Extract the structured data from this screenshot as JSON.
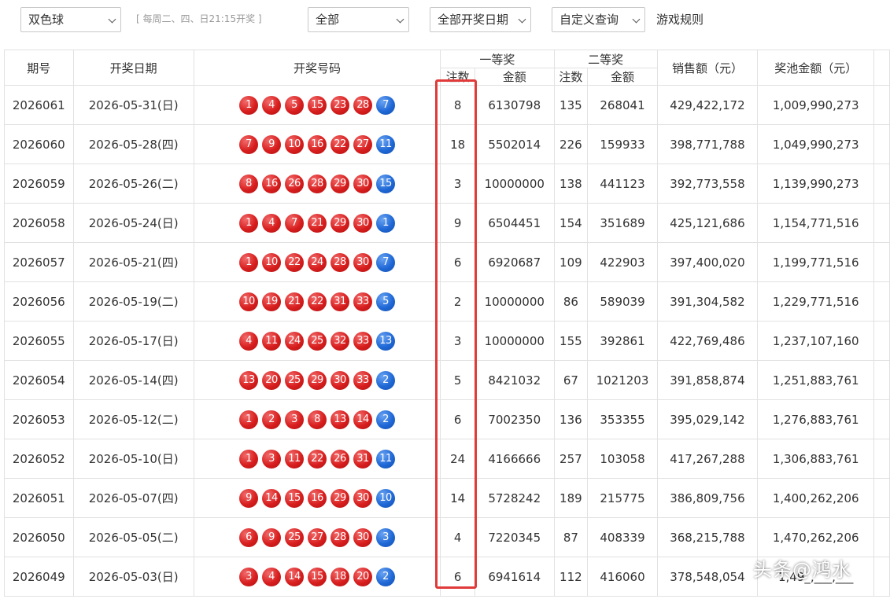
{
  "toolbar": {
    "game_select": "双色球",
    "draw_hint": "[ 每周二、四、日21:15开奖 ]",
    "range_select": "全部",
    "date_select": "全部开奖日期",
    "custom_query": "自定义查询",
    "rules_link": "游戏规则"
  },
  "table": {
    "headers": {
      "issue": "期号",
      "date": "开奖日期",
      "numbers": "开奖号码",
      "first_prize": "一等奖",
      "second_prize": "二等奖",
      "bets": "注数",
      "amount": "金额",
      "sales": "销售额（元）",
      "pool": "奖池金额（元）"
    },
    "rows": [
      {
        "issue": "2026061",
        "date": "2026-05-31(日)",
        "red": [
          "1",
          "4",
          "5",
          "15",
          "23",
          "28"
        ],
        "blue": "7",
        "p1_count": "8",
        "p1_amount": "6130798",
        "p2_count": "135",
        "p2_amount": "268041",
        "sales": "429,422,172",
        "pool": "1,009,990,273"
      },
      {
        "issue": "2026060",
        "date": "2026-05-28(四)",
        "red": [
          "7",
          "9",
          "10",
          "16",
          "22",
          "27"
        ],
        "blue": "11",
        "p1_count": "18",
        "p1_amount": "5502014",
        "p2_count": "226",
        "p2_amount": "159933",
        "sales": "398,771,788",
        "pool": "1,049,990,273"
      },
      {
        "issue": "2026059",
        "date": "2026-05-26(二)",
        "red": [
          "8",
          "16",
          "26",
          "28",
          "29",
          "30"
        ],
        "blue": "15",
        "p1_count": "3",
        "p1_amount": "10000000",
        "p2_count": "138",
        "p2_amount": "441123",
        "sales": "392,773,558",
        "pool": "1,139,990,273"
      },
      {
        "issue": "2026058",
        "date": "2026-05-24(日)",
        "red": [
          "1",
          "4",
          "7",
          "21",
          "29",
          "30"
        ],
        "blue": "1",
        "p1_count": "9",
        "p1_amount": "6504451",
        "p2_count": "154",
        "p2_amount": "351689",
        "sales": "425,121,686",
        "pool": "1,154,771,516"
      },
      {
        "issue": "2026057",
        "date": "2026-05-21(四)",
        "red": [
          "1",
          "10",
          "22",
          "24",
          "28",
          "30"
        ],
        "blue": "7",
        "p1_count": "6",
        "p1_amount": "6920687",
        "p2_count": "109",
        "p2_amount": "422903",
        "sales": "397,400,020",
        "pool": "1,199,771,516"
      },
      {
        "issue": "2026056",
        "date": "2026-05-19(二)",
        "red": [
          "10",
          "19",
          "21",
          "22",
          "31",
          "33"
        ],
        "blue": "5",
        "p1_count": "2",
        "p1_amount": "10000000",
        "p2_count": "86",
        "p2_amount": "589039",
        "sales": "391,304,582",
        "pool": "1,229,771,516"
      },
      {
        "issue": "2026055",
        "date": "2026-05-17(日)",
        "red": [
          "4",
          "11",
          "24",
          "25",
          "32",
          "33"
        ],
        "blue": "13",
        "p1_count": "3",
        "p1_amount": "10000000",
        "p2_count": "155",
        "p2_amount": "392861",
        "sales": "422,769,486",
        "pool": "1,237,107,160"
      },
      {
        "issue": "2026054",
        "date": "2026-05-14(四)",
        "red": [
          "13",
          "20",
          "25",
          "29",
          "30",
          "33"
        ],
        "blue": "2",
        "p1_count": "5",
        "p1_amount": "8421032",
        "p2_count": "67",
        "p2_amount": "1021203",
        "sales": "391,858,874",
        "pool": "1,251,883,761"
      },
      {
        "issue": "2026053",
        "date": "2026-05-12(二)",
        "red": [
          "1",
          "2",
          "3",
          "8",
          "13",
          "14"
        ],
        "blue": "2",
        "p1_count": "6",
        "p1_amount": "7002350",
        "p2_count": "136",
        "p2_amount": "353355",
        "sales": "395,029,142",
        "pool": "1,276,883,761"
      },
      {
        "issue": "2026052",
        "date": "2026-05-10(日)",
        "red": [
          "1",
          "3",
          "11",
          "22",
          "26",
          "31"
        ],
        "blue": "11",
        "p1_count": "24",
        "p1_amount": "4166666",
        "p2_count": "257",
        "p2_amount": "103058",
        "sales": "417,267,288",
        "pool": "1,306,883,761"
      },
      {
        "issue": "2026051",
        "date": "2026-05-07(四)",
        "red": [
          "9",
          "14",
          "15",
          "16",
          "29",
          "30"
        ],
        "blue": "10",
        "p1_count": "14",
        "p1_amount": "5728242",
        "p2_count": "189",
        "p2_amount": "215775",
        "sales": "386,809,756",
        "pool": "1,400,262,206"
      },
      {
        "issue": "2026050",
        "date": "2026-05-05(二)",
        "red": [
          "6",
          "9",
          "25",
          "27",
          "28",
          "30"
        ],
        "blue": "3",
        "p1_count": "4",
        "p1_amount": "7220345",
        "p2_count": "87",
        "p2_amount": "408339",
        "sales": "368,215,788",
        "pool": "1,470,262,206"
      },
      {
        "issue": "2026049",
        "date": "2026-05-03(日)",
        "red": [
          "3",
          "4",
          "14",
          "15",
          "18",
          "20"
        ],
        "blue": "2",
        "p1_count": "6",
        "p1_amount": "6941614",
        "p2_count": "112",
        "p2_amount": "416060",
        "sales": "378,548,054",
        "pool": "1,49_,___,___"
      }
    ]
  },
  "watermark": "头条@鸿水",
  "colors": {
    "red_ball": "#d81e1e",
    "blue_ball": "#1f68d6",
    "highlight": "#e03a3a"
  }
}
